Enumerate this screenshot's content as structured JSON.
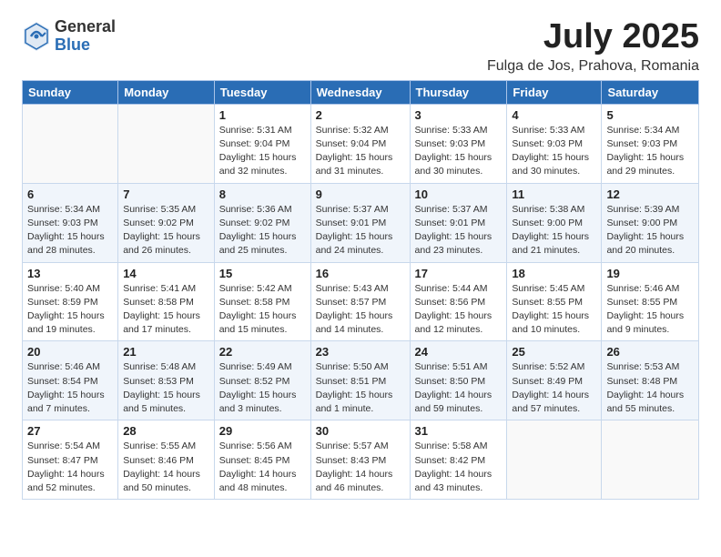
{
  "logo": {
    "general": "General",
    "blue": "Blue"
  },
  "title": "July 2025",
  "location": "Fulga de Jos, Prahova, Romania",
  "weekdays": [
    "Sunday",
    "Monday",
    "Tuesday",
    "Wednesday",
    "Thursday",
    "Friday",
    "Saturday"
  ],
  "weeks": [
    [
      {
        "day": "",
        "info": ""
      },
      {
        "day": "",
        "info": ""
      },
      {
        "day": "1",
        "info": "Sunrise: 5:31 AM\nSunset: 9:04 PM\nDaylight: 15 hours\nand 32 minutes."
      },
      {
        "day": "2",
        "info": "Sunrise: 5:32 AM\nSunset: 9:04 PM\nDaylight: 15 hours\nand 31 minutes."
      },
      {
        "day": "3",
        "info": "Sunrise: 5:33 AM\nSunset: 9:03 PM\nDaylight: 15 hours\nand 30 minutes."
      },
      {
        "day": "4",
        "info": "Sunrise: 5:33 AM\nSunset: 9:03 PM\nDaylight: 15 hours\nand 30 minutes."
      },
      {
        "day": "5",
        "info": "Sunrise: 5:34 AM\nSunset: 9:03 PM\nDaylight: 15 hours\nand 29 minutes."
      }
    ],
    [
      {
        "day": "6",
        "info": "Sunrise: 5:34 AM\nSunset: 9:03 PM\nDaylight: 15 hours\nand 28 minutes."
      },
      {
        "day": "7",
        "info": "Sunrise: 5:35 AM\nSunset: 9:02 PM\nDaylight: 15 hours\nand 26 minutes."
      },
      {
        "day": "8",
        "info": "Sunrise: 5:36 AM\nSunset: 9:02 PM\nDaylight: 15 hours\nand 25 minutes."
      },
      {
        "day": "9",
        "info": "Sunrise: 5:37 AM\nSunset: 9:01 PM\nDaylight: 15 hours\nand 24 minutes."
      },
      {
        "day": "10",
        "info": "Sunrise: 5:37 AM\nSunset: 9:01 PM\nDaylight: 15 hours\nand 23 minutes."
      },
      {
        "day": "11",
        "info": "Sunrise: 5:38 AM\nSunset: 9:00 PM\nDaylight: 15 hours\nand 21 minutes."
      },
      {
        "day": "12",
        "info": "Sunrise: 5:39 AM\nSunset: 9:00 PM\nDaylight: 15 hours\nand 20 minutes."
      }
    ],
    [
      {
        "day": "13",
        "info": "Sunrise: 5:40 AM\nSunset: 8:59 PM\nDaylight: 15 hours\nand 19 minutes."
      },
      {
        "day": "14",
        "info": "Sunrise: 5:41 AM\nSunset: 8:58 PM\nDaylight: 15 hours\nand 17 minutes."
      },
      {
        "day": "15",
        "info": "Sunrise: 5:42 AM\nSunset: 8:58 PM\nDaylight: 15 hours\nand 15 minutes."
      },
      {
        "day": "16",
        "info": "Sunrise: 5:43 AM\nSunset: 8:57 PM\nDaylight: 15 hours\nand 14 minutes."
      },
      {
        "day": "17",
        "info": "Sunrise: 5:44 AM\nSunset: 8:56 PM\nDaylight: 15 hours\nand 12 minutes."
      },
      {
        "day": "18",
        "info": "Sunrise: 5:45 AM\nSunset: 8:55 PM\nDaylight: 15 hours\nand 10 minutes."
      },
      {
        "day": "19",
        "info": "Sunrise: 5:46 AM\nSunset: 8:55 PM\nDaylight: 15 hours\nand 9 minutes."
      }
    ],
    [
      {
        "day": "20",
        "info": "Sunrise: 5:46 AM\nSunset: 8:54 PM\nDaylight: 15 hours\nand 7 minutes."
      },
      {
        "day": "21",
        "info": "Sunrise: 5:48 AM\nSunset: 8:53 PM\nDaylight: 15 hours\nand 5 minutes."
      },
      {
        "day": "22",
        "info": "Sunrise: 5:49 AM\nSunset: 8:52 PM\nDaylight: 15 hours\nand 3 minutes."
      },
      {
        "day": "23",
        "info": "Sunrise: 5:50 AM\nSunset: 8:51 PM\nDaylight: 15 hours\nand 1 minute."
      },
      {
        "day": "24",
        "info": "Sunrise: 5:51 AM\nSunset: 8:50 PM\nDaylight: 14 hours\nand 59 minutes."
      },
      {
        "day": "25",
        "info": "Sunrise: 5:52 AM\nSunset: 8:49 PM\nDaylight: 14 hours\nand 57 minutes."
      },
      {
        "day": "26",
        "info": "Sunrise: 5:53 AM\nSunset: 8:48 PM\nDaylight: 14 hours\nand 55 minutes."
      }
    ],
    [
      {
        "day": "27",
        "info": "Sunrise: 5:54 AM\nSunset: 8:47 PM\nDaylight: 14 hours\nand 52 minutes."
      },
      {
        "day": "28",
        "info": "Sunrise: 5:55 AM\nSunset: 8:46 PM\nDaylight: 14 hours\nand 50 minutes."
      },
      {
        "day": "29",
        "info": "Sunrise: 5:56 AM\nSunset: 8:45 PM\nDaylight: 14 hours\nand 48 minutes."
      },
      {
        "day": "30",
        "info": "Sunrise: 5:57 AM\nSunset: 8:43 PM\nDaylight: 14 hours\nand 46 minutes."
      },
      {
        "day": "31",
        "info": "Sunrise: 5:58 AM\nSunset: 8:42 PM\nDaylight: 14 hours\nand 43 minutes."
      },
      {
        "day": "",
        "info": ""
      },
      {
        "day": "",
        "info": ""
      }
    ]
  ]
}
